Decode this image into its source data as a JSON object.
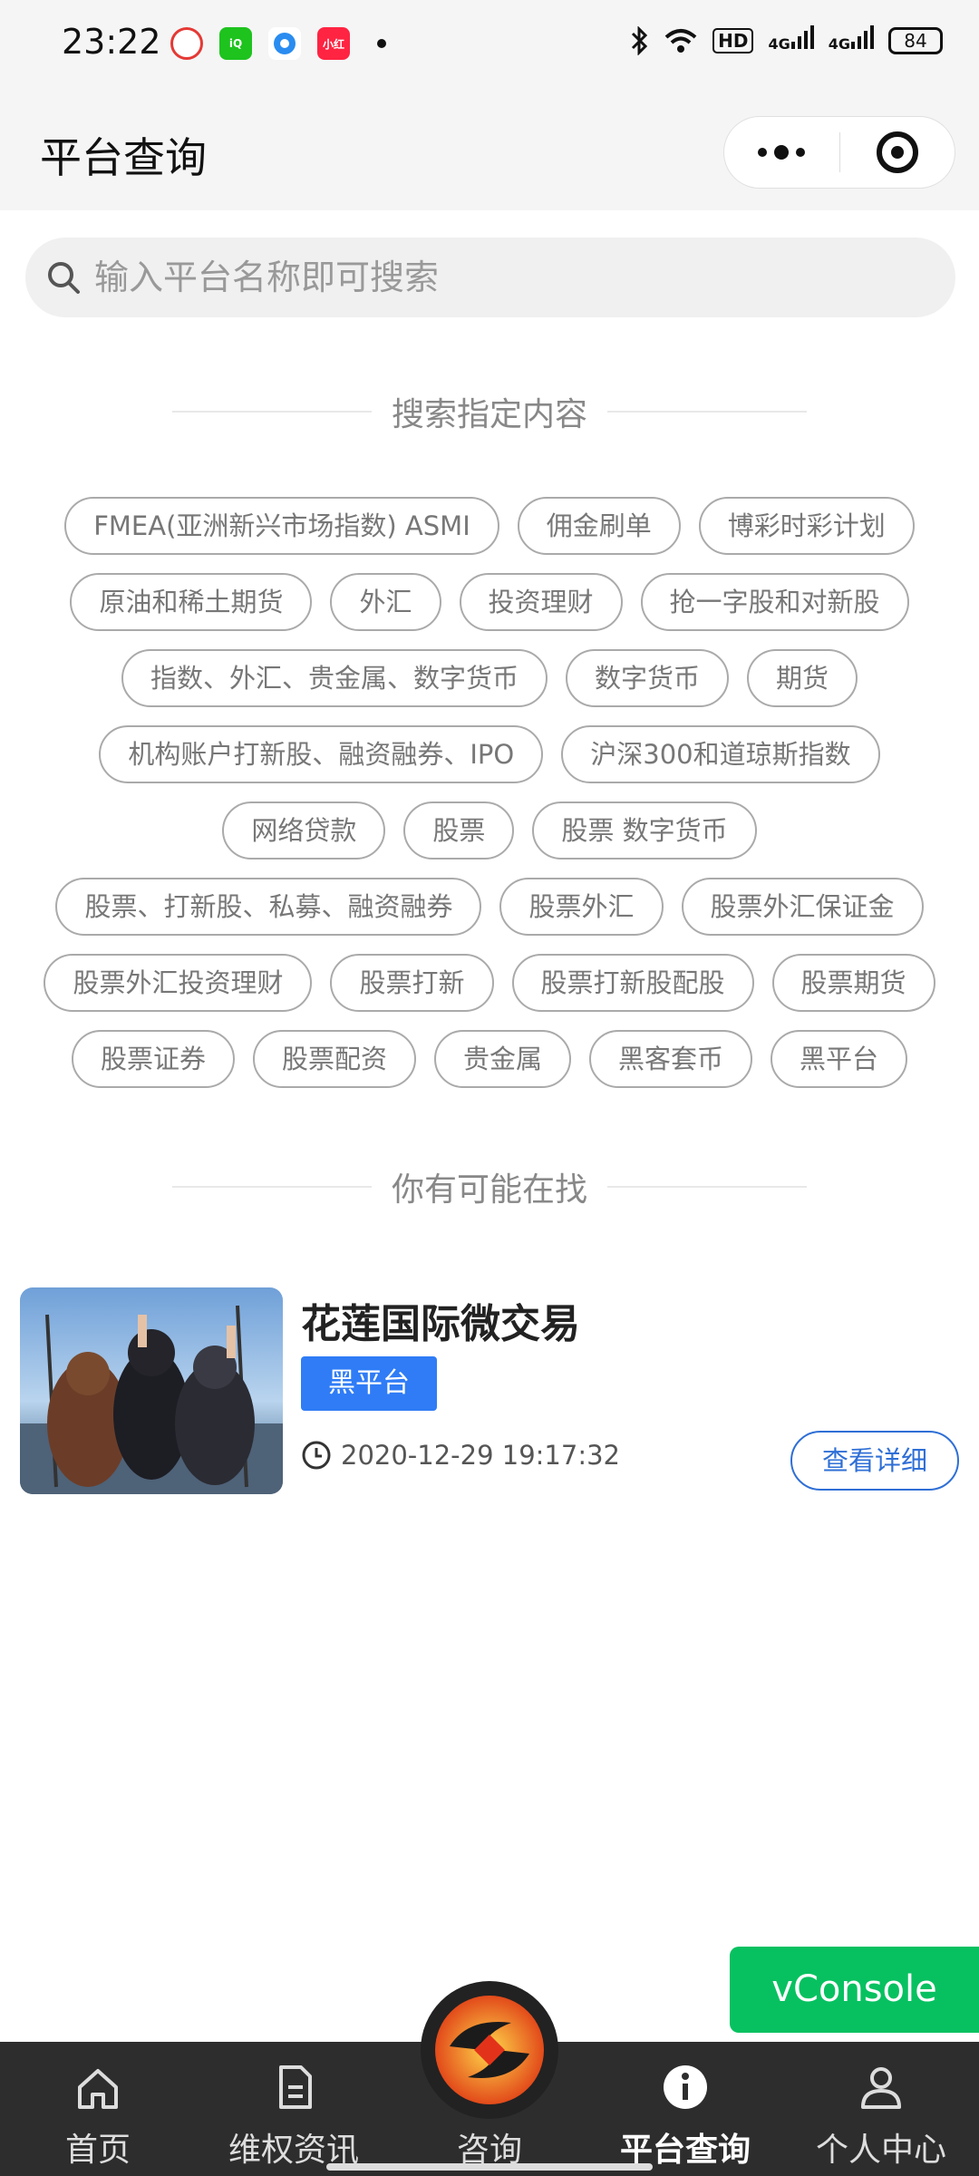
{
  "status_bar": {
    "time": "23:22",
    "battery": "84",
    "hd": "HD",
    "signal1": "4G",
    "signal2": "4G",
    "app_icons": [
      "browser-icon",
      "iqiyi-icon",
      "circle-app-icon",
      "xiaohongshu-icon"
    ]
  },
  "header": {
    "title": "平台查询"
  },
  "search": {
    "placeholder": "输入平台名称即可搜索"
  },
  "tags_section": {
    "title": "搜索指定内容",
    "tags": [
      "FMEA(亚洲新兴市场指数) ASMI",
      "佣金刷单",
      "博彩时彩计划",
      "原油和稀土期货",
      "外汇",
      "投资理财",
      "抢一字股和对新股",
      "指数、外汇、贵金属、数字货币",
      "数字货币",
      "期货",
      "机构账户打新股、融资融券、IPO",
      "沪深300和道琼斯指数",
      "网络贷款",
      "股票",
      "股票 数字货币",
      "股票、打新股、私募、融资融券",
      "股票外汇",
      "股票外汇保证金",
      "股票外汇投资理财",
      "股票打新",
      "股票打新股配股",
      "股票期货",
      "股票证券",
      "股票配资",
      "贵金属",
      "黑客套币",
      "黑平台"
    ]
  },
  "results_section": {
    "title": "你有可能在找",
    "items": [
      {
        "title": "花莲国际微交易",
        "badge": "黑平台",
        "time": "2020-12-29 19:17:32",
        "button": "查看详细"
      }
    ]
  },
  "vconsole": {
    "label": "vConsole"
  },
  "tabbar": {
    "tabs": [
      {
        "label": "首页",
        "icon": "home-icon"
      },
      {
        "label": "维权资讯",
        "icon": "document-icon"
      },
      {
        "label": "咨询",
        "icon": "logo-icon"
      },
      {
        "label": "平台查询",
        "icon": "info-icon",
        "active": true
      },
      {
        "label": "个人中心",
        "icon": "user-icon"
      }
    ]
  },
  "colors": {
    "accent": "#2f7cf6",
    "vconsole": "#07c160",
    "tabbar": "#2d2d2d"
  }
}
